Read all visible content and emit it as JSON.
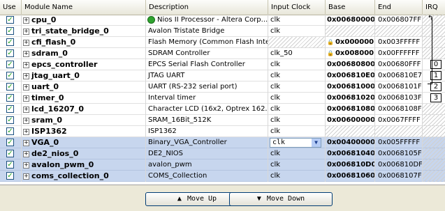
{
  "headers": {
    "use": "Use",
    "module_name": "Module Name",
    "description": "Description",
    "input_clock": "Input Clock",
    "base": "Base",
    "end": "End",
    "irq": "IRQ"
  },
  "rows": [
    {
      "name": "cpu_0",
      "desc": "Nios II Processor - Altera Corp...",
      "clock": "clk",
      "base": "0x00680000",
      "end": "0x006807FF",
      "irq": "",
      "selected": false
    },
    {
      "name": "tri_state_bridge_0",
      "desc": "Avalon Tristate Bridge",
      "clock": "clk",
      "base": "",
      "end": "",
      "irq": "",
      "selected": false
    },
    {
      "name": "cfi_flash_0",
      "desc": "Flash Memory (Common Flash Inte...",
      "clock": "",
      "base": "0x000000...",
      "end": "0x003FFFFF",
      "irq": "",
      "selected": false
    },
    {
      "name": "sdram_0",
      "desc": "SDRAM Controller",
      "clock": "clk_50",
      "base": "0x008000...",
      "end": "0x00FFFFFF",
      "irq": "",
      "selected": false
    },
    {
      "name": "epcs_controller",
      "desc": "EPCS Serial Flash Controller",
      "clock": "clk",
      "base": "0x00680800",
      "end": "0x00680FFF",
      "irq": "0",
      "selected": false
    },
    {
      "name": "jtag_uart_0",
      "desc": "JTAG UART",
      "clock": "clk",
      "base": "0x006810E0",
      "end": "0x006810E7",
      "irq": "1",
      "selected": false
    },
    {
      "name": "uart_0",
      "desc": "UART (RS-232 serial port)",
      "clock": "clk",
      "base": "0x00681000",
      "end": "0x0068101F",
      "irq": "2",
      "selected": false
    },
    {
      "name": "timer_0",
      "desc": "Interval timer",
      "clock": "clk",
      "base": "0x00681020",
      "end": "0x0068103F",
      "irq": "3",
      "selected": false
    },
    {
      "name": "lcd_16207_0",
      "desc": "Character LCD (16x2, Optrex 162...",
      "clock": "clk",
      "base": "0x00681080",
      "end": "0x0068108F",
      "irq": "",
      "selected": false
    },
    {
      "name": "sram_0",
      "desc": "SRAM_16Bit_512K",
      "clock": "clk",
      "base": "0x00600000",
      "end": "0x0067FFFF",
      "irq": "",
      "selected": false
    },
    {
      "name": "ISP1362",
      "desc": "ISP1362",
      "clock": "clk",
      "base": "",
      "end": "",
      "irq": "",
      "selected": false
    },
    {
      "name": "VGA_0",
      "desc": "Binary_VGA_Controller",
      "clock": "clk",
      "base": "0x00400000",
      "end": "0x005FFFFF",
      "irq": "",
      "selected": true
    },
    {
      "name": "de2_nios_0",
      "desc": "DE2_NIOS",
      "clock": "clk",
      "base": "0x00681040",
      "end": "0x0068105F",
      "irq": "",
      "selected": true
    },
    {
      "name": "avalon_pwm_0",
      "desc": "avalon_pwm",
      "clock": "clk",
      "base": "0x006810D0",
      "end": "0x006810DF",
      "irq": "",
      "selected": true
    },
    {
      "name": "coms_collection_0",
      "desc": "COMS_Collection",
      "clock": "clk",
      "base": "0x00681060",
      "end": "0x0068107F",
      "irq": "",
      "selected": true
    }
  ],
  "buttons": {
    "move_up": "Move Up",
    "move_down": "Move Down"
  },
  "colors": {
    "selected_row": "#c7d6ee",
    "check": "#21a121",
    "nios_icon": "#2fa32f"
  }
}
